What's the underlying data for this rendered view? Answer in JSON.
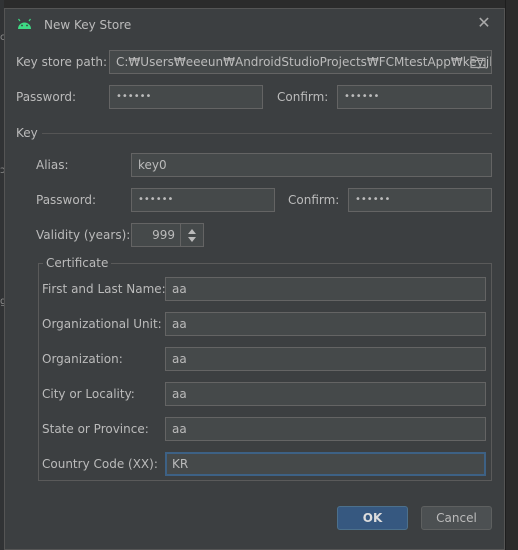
{
  "dialog": {
    "title": "New Key Store",
    "close_glyph": "✕",
    "icon": "android-icon"
  },
  "keystore": {
    "path_label": "Key store path:",
    "path_value": "C:₩Users₩eeeun₩AndroidStudioProjects₩FCMtestApp₩key.jks",
    "browse_icon": "folder-icon",
    "password_label": "Password:",
    "password_value": "••••••",
    "confirm_label": "Confirm:",
    "confirm_value": "••••••"
  },
  "key": {
    "section_label": "Key",
    "alias_label": "Alias:",
    "alias_value": "key0",
    "password_label": "Password:",
    "password_value": "••••••",
    "confirm_label": "Confirm:",
    "confirm_value": "••••••",
    "validity_label": "Validity (years):",
    "validity_value": "999"
  },
  "certificate": {
    "group_label": "Certificate",
    "fields": [
      {
        "label": "First and Last Name:",
        "value": "aa"
      },
      {
        "label": "Organizational Unit:",
        "value": "aa"
      },
      {
        "label": "Organization:",
        "value": "aa"
      },
      {
        "label": "City or Locality:",
        "value": "aa"
      },
      {
        "label": "State or Province:",
        "value": "aa"
      },
      {
        "label": "Country Code (XX):",
        "value": "KR"
      }
    ]
  },
  "buttons": {
    "ok": "OK",
    "cancel": "Cancel"
  },
  "colors": {
    "dialog_bg": "#3c3f41",
    "field_bg": "#45494a",
    "accent": "#365880",
    "focus_border": "#3d6185",
    "android_green": "#3ddc84"
  }
}
